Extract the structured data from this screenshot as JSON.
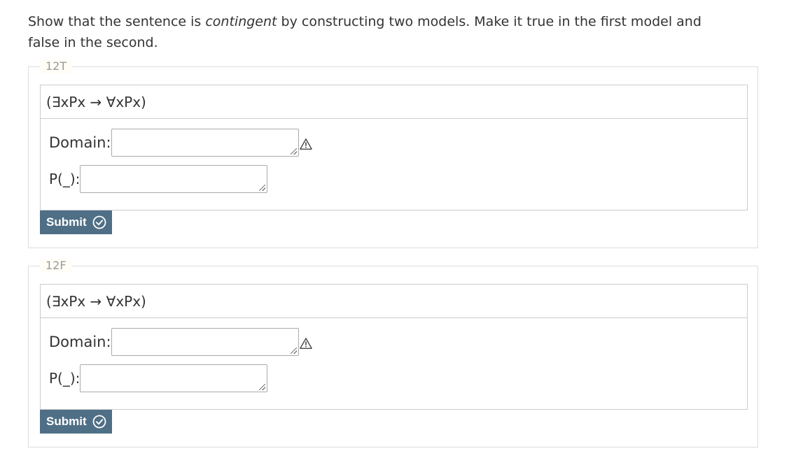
{
  "instructions": {
    "before": "Show that the sentence is ",
    "emphasis": "contingent",
    "after": " by constructing two models. Make it true in the first model and false in the second."
  },
  "models": [
    {
      "legend": "12T",
      "sentence": "(∃xPx → ∀xPx)",
      "domain_label": "Domain:",
      "domain_value": "",
      "predicate_label": "P(_):",
      "predicate_value": "",
      "submit_label": "Submit"
    },
    {
      "legend": "12F",
      "sentence": "(∃xPx → ∀xPx)",
      "domain_label": "Domain:",
      "domain_value": "",
      "predicate_label": "P(_):",
      "predicate_value": "",
      "submit_label": "Submit"
    }
  ],
  "icons": {
    "warning": "warning-triangle-icon",
    "submit": "check-circle-icon"
  },
  "colors": {
    "submit_bg": "#4f6f86",
    "border": "#cccccc",
    "legend_text": "#999999"
  }
}
